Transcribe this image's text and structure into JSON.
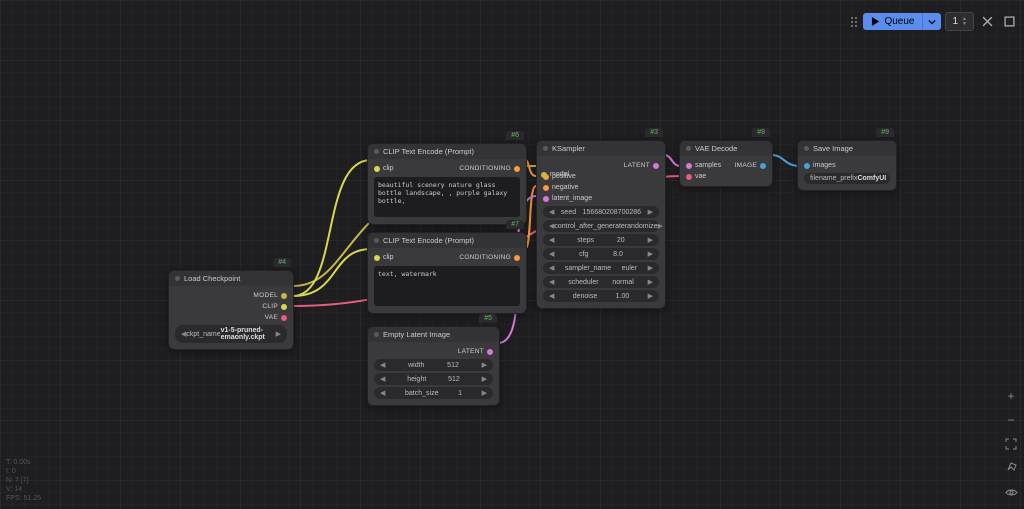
{
  "toolbar": {
    "queue_label": "Queue",
    "count": "1"
  },
  "stats": {
    "l1": "T: 0.00s",
    "l2": "I: 0",
    "l3": "N: 7 [7]",
    "l4": "V: 14",
    "l5": "FPS: 51.25"
  },
  "nodes": {
    "load_ckpt": {
      "badge": "#4",
      "title": "Load Checkpoint",
      "out_model": "MODEL",
      "out_clip": "CLIP",
      "out_vae": "VAE",
      "ckpt_label": "ckpt_name",
      "ckpt_value": "v1-5-pruned-emaonly.ckpt"
    },
    "clip1": {
      "badge": "#6",
      "title": "CLIP Text Encode (Prompt)",
      "in_clip": "clip",
      "out_cond": "CONDITIONING",
      "text": "beautiful scenery nature glass bottle landscape, , purple galaxy bottle,"
    },
    "clip2": {
      "badge": "#7",
      "title": "CLIP Text Encode (Prompt)",
      "in_clip": "clip",
      "out_cond": "CONDITIONING",
      "text": "text, watermark"
    },
    "empty_latent": {
      "badge": "#5",
      "title": "Empty Latent Image",
      "out_latent": "LATENT",
      "width_label": "width",
      "width_value": "512",
      "height_label": "height",
      "height_value": "512",
      "batch_label": "batch_size",
      "batch_value": "1"
    },
    "ksampler": {
      "badge": "#3",
      "title": "KSampler",
      "in_model": "model",
      "in_positive": "positive",
      "in_negative": "negative",
      "in_latent": "latent_image",
      "out_latent": "LATENT",
      "seed_label": "seed",
      "seed_value": "156680208700286",
      "ctrl_label": "control_after_generate",
      "ctrl_value": "randomize",
      "steps_label": "steps",
      "steps_value": "20",
      "cfg_label": "cfg",
      "cfg_value": "8.0",
      "sampler_label": "sampler_name",
      "sampler_value": "euler",
      "sched_label": "scheduler",
      "sched_value": "normal",
      "denoise_label": "denoise",
      "denoise_value": "1.00"
    },
    "vae_decode": {
      "badge": "#8",
      "title": "VAE Decode",
      "in_samples": "samples",
      "in_vae": "vae",
      "out_image": "IMAGE"
    },
    "save_image": {
      "badge": "#9",
      "title": "Save Image",
      "in_images": "images",
      "prefix_label": "filename_prefix",
      "prefix_value": "ComfyUI"
    }
  }
}
